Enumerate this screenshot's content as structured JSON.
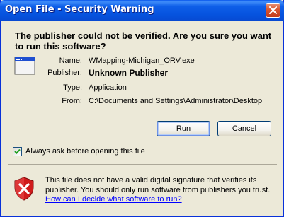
{
  "window": {
    "title": "Open File - Security Warning"
  },
  "headline": "The publisher could not be verified.  Are you sure you want to run this software?",
  "details": {
    "name_label": "Name:",
    "name_value": "WMapping-Michigan_ORV.exe",
    "publisher_label": "Publisher:",
    "publisher_value": "Unknown Publisher",
    "type_label": "Type:",
    "type_value": "Application",
    "from_label": "From:",
    "from_value": "C:\\Documents and Settings\\Administrator\\Desktop"
  },
  "buttons": {
    "run_label": "Run",
    "cancel_label": "Cancel"
  },
  "checkbox": {
    "label": "Always ask before opening this file",
    "checked": true
  },
  "warning": {
    "text": "This file does not have a valid digital signature that verifies its publisher.  You should only run software from publishers you trust.",
    "link_text": "How can I decide what software to run?"
  },
  "icons": {
    "close": "close-icon",
    "app": "application-window-icon",
    "check": "checkmark-icon",
    "shield": "security-shield-icon"
  },
  "colors": {
    "titlebar": "#0653de",
    "close_button": "#d8552f",
    "dialog_bg": "#ece9d8",
    "link": "#0000ff",
    "shield_red": "#d01c1c"
  }
}
